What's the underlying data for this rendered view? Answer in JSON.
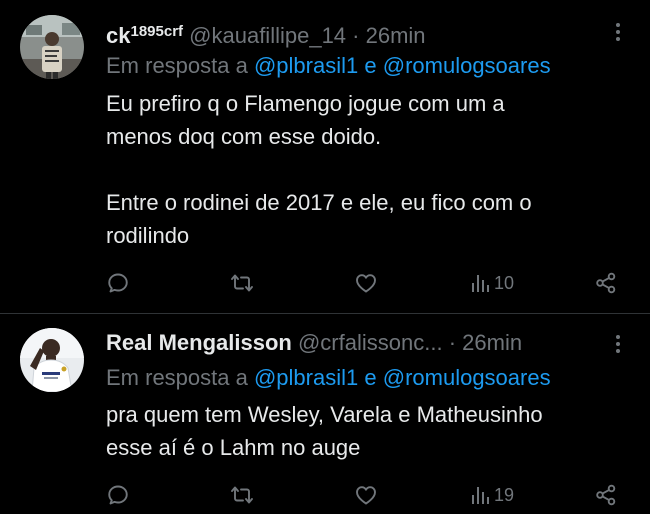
{
  "tweets": [
    {
      "display_name": "ck",
      "name_superscript": "1895crf",
      "handle": "@kauafillipe_14",
      "separator": "·",
      "time": "26min",
      "reply_prefix": "Em resposta a",
      "reply_user1": "@plbrasil1",
      "reply_and": "e",
      "reply_user2": "@romulogsoares",
      "text": "Eu prefiro q o Flamengo jogue com um a\nmenos doq com esse doido.\n\nEntre o rodinei de 2017 e ele, eu fico com o\nrodilindo",
      "views": "10"
    },
    {
      "display_name": "Real Mengalisson",
      "name_superscript": "",
      "handle": "@crfalissonc...",
      "separator": "·",
      "time": "26min",
      "reply_prefix": "Em resposta a",
      "reply_user1": "@plbrasil1",
      "reply_and": "e",
      "reply_user2": "@romulogsoares",
      "text": "pra quem tem Wesley, Varela e Matheusinho\nesse aí é o Lahm no auge",
      "views": "19"
    }
  ],
  "colors": {
    "background": "#000000",
    "text": "#e7e9ea",
    "secondary": "#71767b",
    "link": "#1d9bf0",
    "divider": "#2f3336"
  },
  "icons": [
    "reply-icon",
    "retweet-icon",
    "like-icon",
    "views-icon",
    "share-icon",
    "more-icon"
  ]
}
